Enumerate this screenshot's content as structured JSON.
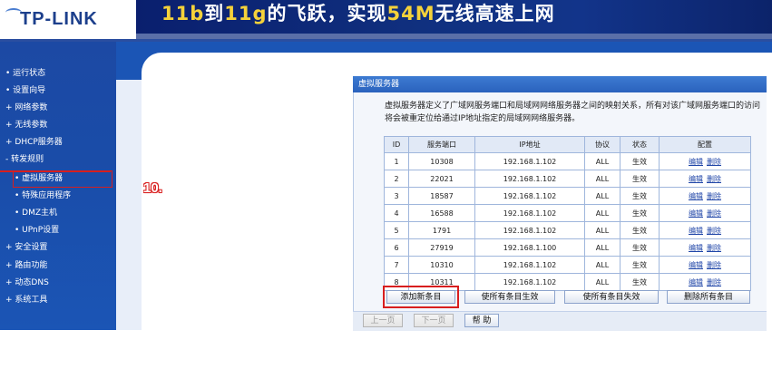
{
  "header": {
    "logo": "TP-LINK",
    "banner_part1": "11b",
    "banner_part2": "到",
    "banner_part3": "11g",
    "banner_part4": "的飞跃，实现",
    "banner_part5": "54M",
    "banner_part6": "无线高速上网"
  },
  "sidebar": {
    "items": [
      {
        "label": "• 运行状态"
      },
      {
        "label": "• 设置向导"
      },
      {
        "label": "+ 网络参数"
      },
      {
        "label": "+ 无线参数"
      },
      {
        "label": "+ DHCP服务器"
      },
      {
        "label": "- 转发规则"
      },
      {
        "label": "• 虚拟服务器"
      },
      {
        "label": "• 特殊应用程序"
      },
      {
        "label": "• DMZ主机"
      },
      {
        "label": "• UPnP设置"
      },
      {
        "label": "+ 安全设置"
      },
      {
        "label": "+ 路由功能"
      },
      {
        "label": "+ 动态DNS"
      },
      {
        "label": "+ 系统工具"
      }
    ]
  },
  "step_label": "10.",
  "panel": {
    "title": "虚拟服务器",
    "description": "虚拟服务器定义了广域网服务端口和局域网网络服务器之间的映射关系，所有对该广域网服务端口的访问将会被重定位给通过IP地址指定的局域网网络服务器。"
  },
  "table": {
    "headers": [
      "ID",
      "服务端口",
      "IP地址",
      "协议",
      "状态",
      "配置"
    ],
    "rows": [
      {
        "id": "1",
        "port": "10308",
        "ip": "192.168.1.102",
        "protocol": "ALL",
        "status": "生效",
        "edit": "编辑",
        "delete": "删除"
      },
      {
        "id": "2",
        "port": "22021",
        "ip": "192.168.1.102",
        "protocol": "ALL",
        "status": "生效",
        "edit": "编辑",
        "delete": "删除"
      },
      {
        "id": "3",
        "port": "18587",
        "ip": "192.168.1.102",
        "protocol": "ALL",
        "status": "生效",
        "edit": "编辑",
        "delete": "删除"
      },
      {
        "id": "4",
        "port": "16588",
        "ip": "192.168.1.102",
        "protocol": "ALL",
        "status": "生效",
        "edit": "编辑",
        "delete": "删除"
      },
      {
        "id": "5",
        "port": "1791",
        "ip": "192.168.1.102",
        "protocol": "ALL",
        "status": "生效",
        "edit": "编辑",
        "delete": "删除"
      },
      {
        "id": "6",
        "port": "27919",
        "ip": "192.168.1.100",
        "protocol": "ALL",
        "status": "生效",
        "edit": "编辑",
        "delete": "删除"
      },
      {
        "id": "7",
        "port": "10310",
        "ip": "192.168.1.102",
        "protocol": "ALL",
        "status": "生效",
        "edit": "编辑",
        "delete": "删除"
      },
      {
        "id": "8",
        "port": "10311",
        "ip": "192.168.1.102",
        "protocol": "ALL",
        "status": "生效",
        "edit": "编辑",
        "delete": "删除"
      }
    ]
  },
  "buttons": {
    "add": "添加新条目",
    "enable_all": "使所有条目生效",
    "disable_all": "使所有条目失效",
    "delete_all": "删除所有条目",
    "prev": "上一页",
    "next": "下一页",
    "help": "帮 助"
  },
  "colors": {
    "sidebar": "#1b55b5",
    "highlight": "#d81e1e",
    "banner": "#10307f"
  }
}
